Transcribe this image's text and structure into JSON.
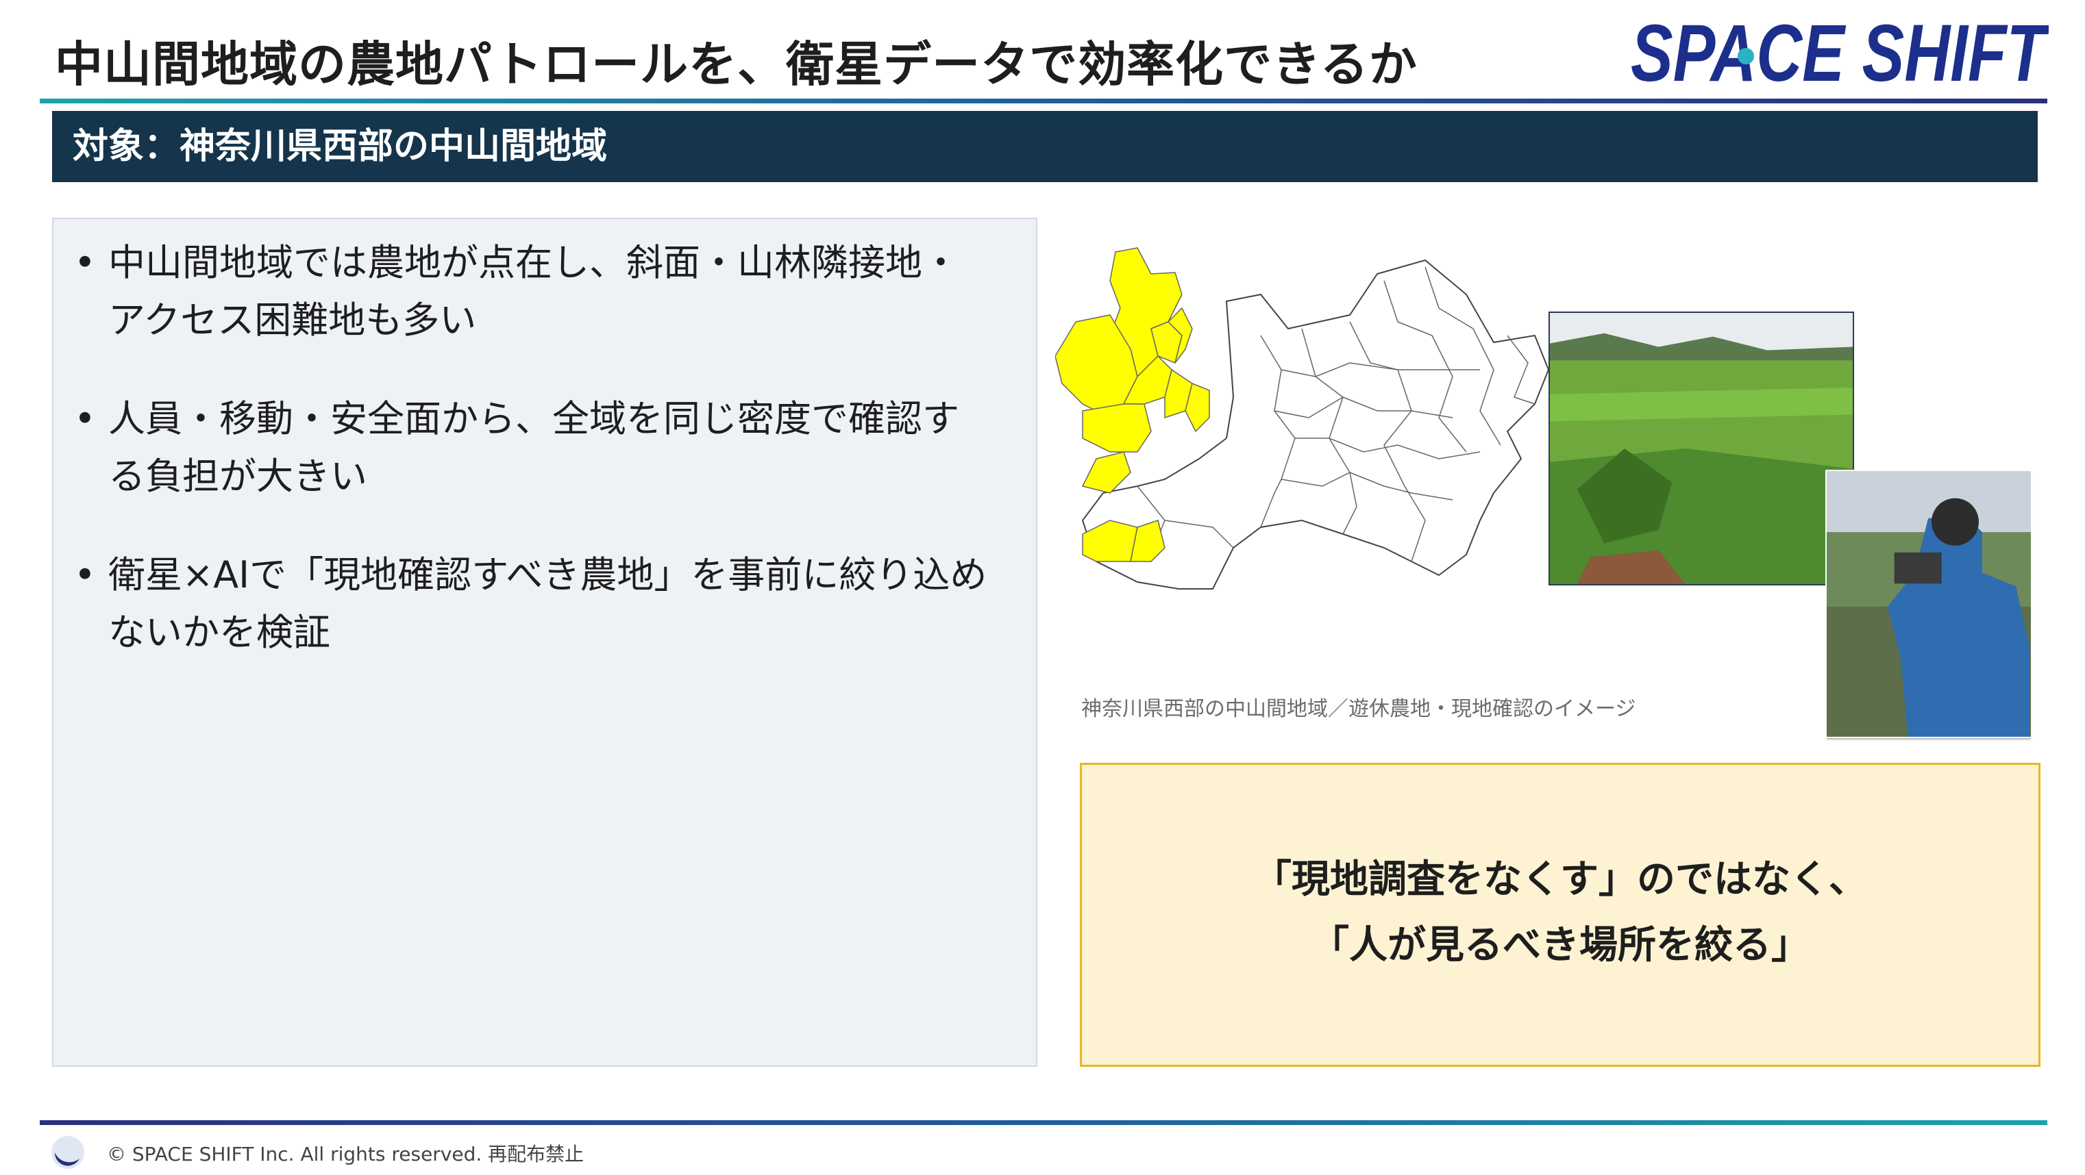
{
  "header": {
    "title": "中山間地域の農地パトロールを、衛星データで効率化できるか",
    "logo_text": "SPACE SHIFT"
  },
  "banner": {
    "text": "対象：神奈川県西部の中山間地域"
  },
  "bullets": [
    {
      "line1": "中山間地域では農地が点在し、斜面・山林隣接地・",
      "line2": "アクセス困難地も多い"
    },
    {
      "line1": "人員・移動・安全面から、全域を同じ密度で確認す",
      "line2": "る負担が大きい"
    },
    {
      "line1": "衛星×AIで「現地確認すべき農地」を事前に絞り込め",
      "line2": "ないかを検証"
    }
  ],
  "bullet_symbol": "•",
  "figure": {
    "caption": "神奈川県西部の中山間地域／遊休農地・現地確認のイメージ",
    "map_highlight_color": "#ffff00"
  },
  "callout": {
    "line1": "「現地調査をなくす」のではなく、",
    "line2": "「人が見るべき場所を絞る」"
  },
  "footer": {
    "copyright": "© SPACE SHIFT Inc. All rights reserved. 再配布禁止"
  },
  "colors": {
    "banner_bg": "#14354c",
    "callout_bg": "#fdf3d3",
    "callout_border": "#e8b724",
    "accent_teal": "#1aa3ad",
    "accent_navy": "#2b2f7d",
    "logo_color": "#1c2f8c"
  }
}
